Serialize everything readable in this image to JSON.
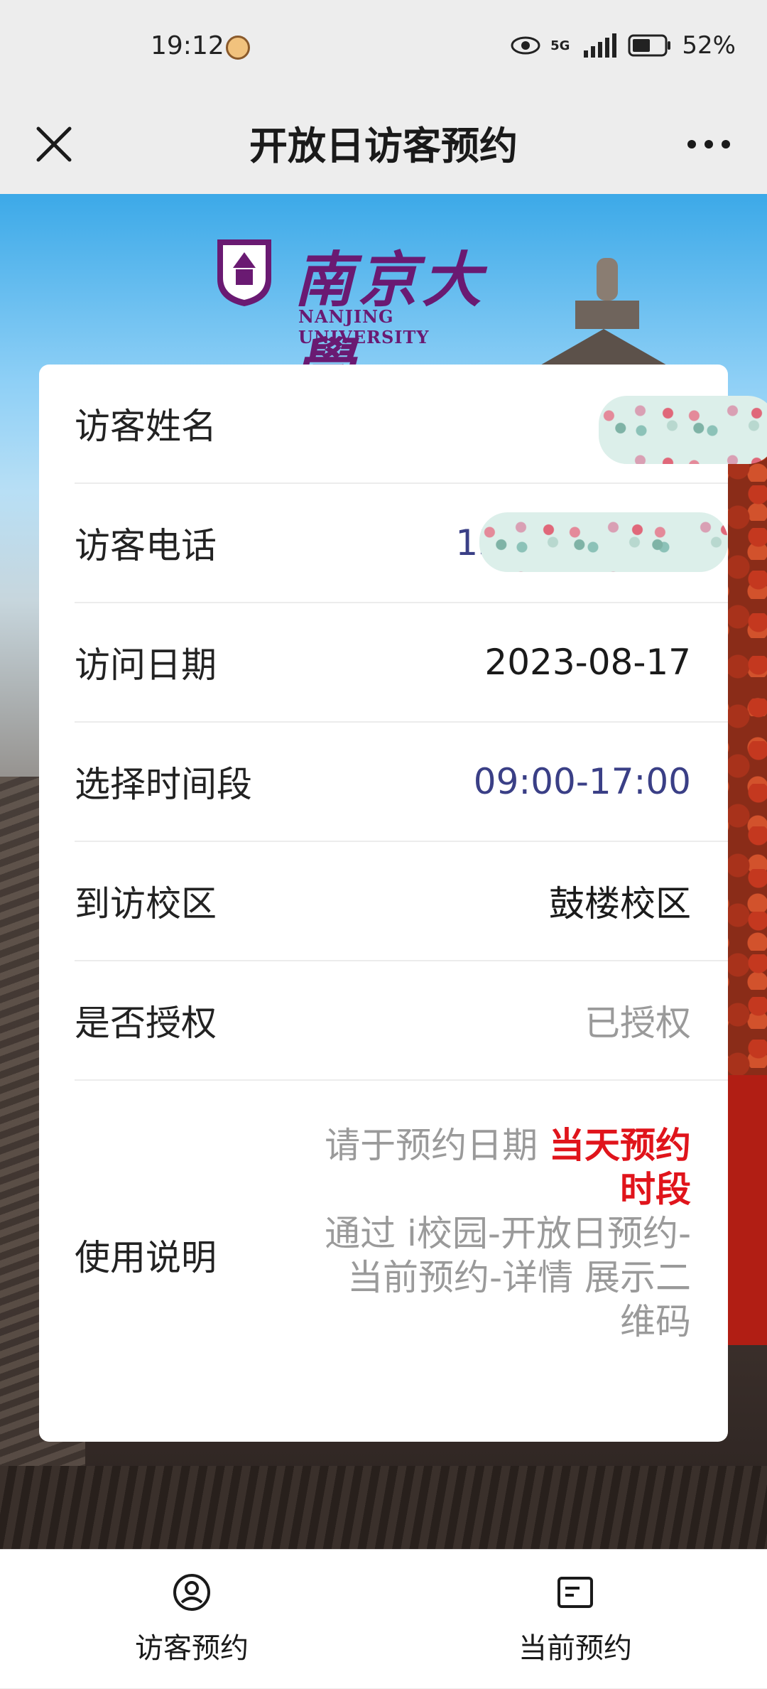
{
  "status_bar": {
    "time": "19:12",
    "network": "5G",
    "battery": "52%"
  },
  "nav": {
    "title": "开放日访客预约",
    "close_icon": "close-icon",
    "more_icon": "more-icon"
  },
  "banner": {
    "school_name": "南京大學",
    "school_name_en": "NANJING UNIVERSITY"
  },
  "form": {
    "visitor_name": {
      "label": "访客姓名",
      "value": ""
    },
    "visitor_phone": {
      "label": "访客电话",
      "value": "13"
    },
    "visit_date": {
      "label": "访问日期",
      "value": "2023-08-17"
    },
    "time_slot": {
      "label": "选择时间段",
      "value": "09:00-17:00"
    },
    "campus": {
      "label": "到访校区",
      "value": "鼓楼校区"
    },
    "authorized": {
      "label": "是否授权",
      "value": "已授权"
    },
    "usage": {
      "label": "使用说明",
      "line1_prefix": "请于预约日期",
      "line1_emphasis": "当天预约时段",
      "line2": "通过 i校园-开放日预约-",
      "line3": "当前预约-详情 展示二维码"
    }
  },
  "tabs": [
    {
      "label": "访客预约",
      "icon": "user-circle-icon"
    },
    {
      "label": "当前预约",
      "icon": "document-list-icon"
    }
  ],
  "colors": {
    "accent_blue": "#3a3f86",
    "emphasis_red": "#e0141b",
    "brand_purple": "#6a1a72"
  }
}
